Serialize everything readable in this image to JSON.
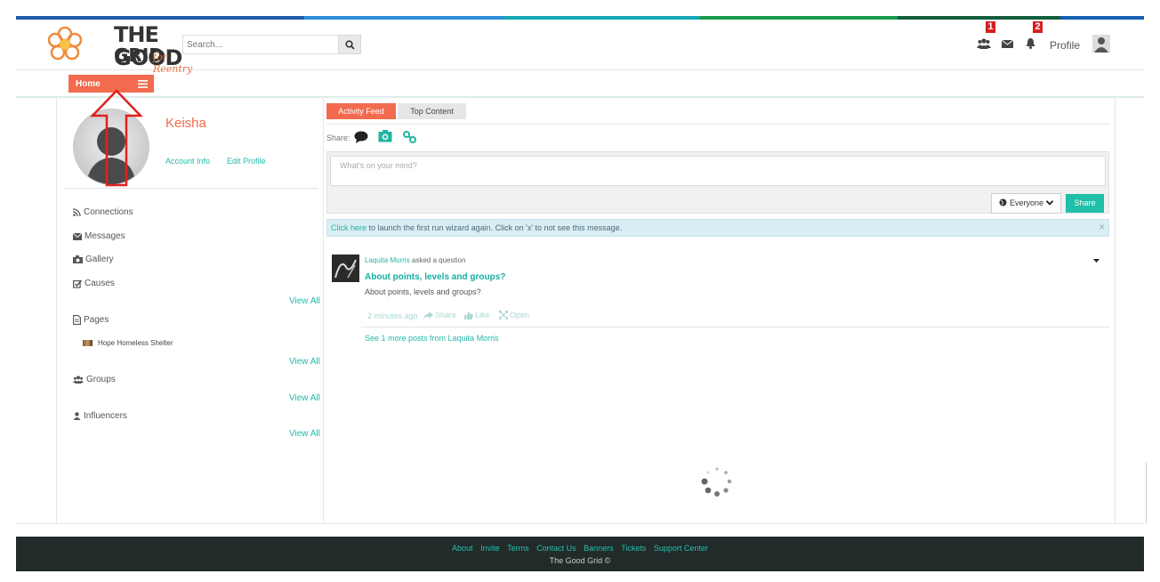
{
  "brand": {
    "logo_line1": "THE GOOD",
    "logo_line2": "GRID",
    "logo_sub": "for Reentry",
    "accent": "#f36b4f",
    "teal": "#23b8a8"
  },
  "header": {
    "search_placeholder": "Search...",
    "badges": {
      "connections": "1",
      "notifications": "2"
    },
    "profile_label": "Profile",
    "icons": [
      "users-icon",
      "envelope-icon",
      "bell-icon",
      "user-avatar-icon"
    ]
  },
  "nav": {
    "home_label": "Home"
  },
  "user": {
    "name": "Keisha",
    "account_info": "Account Info",
    "edit_profile": "Edit Profile"
  },
  "sidebar": {
    "connections": "Connections",
    "messages": "Messages",
    "gallery": "Gallery",
    "causes": "Causes",
    "pages": "Pages",
    "page_item": "Hope Homeless Shelter",
    "groups": "Groups",
    "influencers": "Influencers",
    "view_all": "View All"
  },
  "feed": {
    "tabs": [
      "Activity Feed",
      "Top Content"
    ],
    "share_label": "Share:",
    "composer_placeholder": "What's on your mind?",
    "audience": "Everyone",
    "share_button": "Share",
    "alert_link": "Click here",
    "alert_text": " to launch the first run wizard again. Click on 'x' to not see this message.",
    "alert_close": "×",
    "post": {
      "author": "Laquita Morris",
      "action": " asked a question",
      "title": "About points, levels and groups?",
      "body": "About points, levels and groups?",
      "time": "2 minutes ago",
      "share": "Share",
      "like": "Like",
      "open": "Open",
      "more": "See 1 more posts from Laquita Morris"
    }
  },
  "footer": {
    "links": [
      "About",
      "Invite",
      "Terms",
      "Contact Us",
      "Banners",
      "Tickets",
      "Support Center"
    ],
    "copyright": "The Good Grid ©"
  }
}
